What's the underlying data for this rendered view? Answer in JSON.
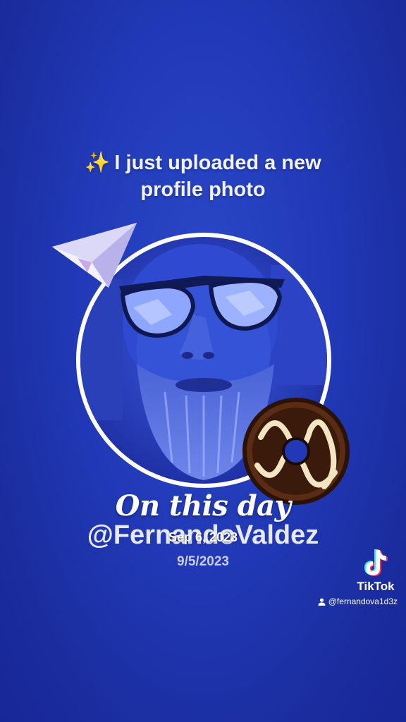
{
  "headline": {
    "sparkle_icon": "sparkles-icon",
    "line1": "I just uploaded a new",
    "line2": "profile photo"
  },
  "avatar": {
    "icon": "profile-photo"
  },
  "stickers": [
    "paper-plane-icon",
    "donut-icon"
  ],
  "memory": {
    "title": "On this day",
    "date": "Sep 6, 2023"
  },
  "profile": {
    "handle": "@FernandoValdez",
    "date": "9/5/2023"
  },
  "watermark": {
    "logo_icon": "tiktok-logo-icon",
    "brand": "TikTok",
    "user_icon": "user-icon",
    "username": "@fernandova1d3z"
  },
  "colors": {
    "background": "#2139b6",
    "ring": "#ffffff",
    "tiktok_cyan": "#25f4ee",
    "tiktok_red": "#fe2c55"
  }
}
